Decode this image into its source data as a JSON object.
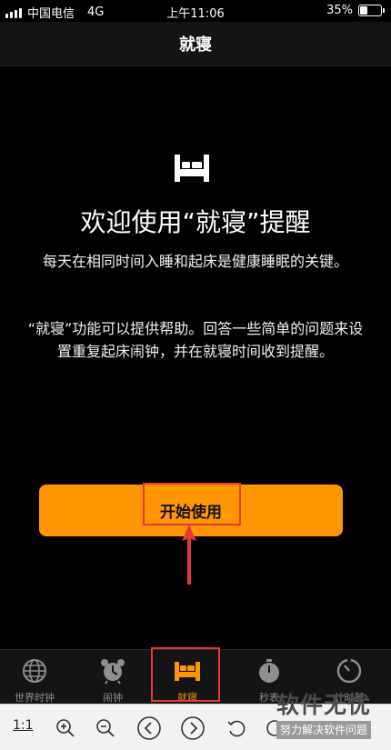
{
  "status_bar": {
    "carrier": "中国电信",
    "network": "4G",
    "time": "上午11:06",
    "battery": "35%",
    "battery_level": 0.35
  },
  "nav": {
    "title": "就寝"
  },
  "content": {
    "heading": "欢迎使用“就寝”提醒",
    "paragraph1": "每天在相同时间入睡和起床是健康睡眠的关键。",
    "paragraph2": "“就寝”功能可以提供帮助。回答一些简单的问题来设置重复起床闹钟，并在就寝时间收到提醒。",
    "start_button": "开始使用"
  },
  "tabs": [
    {
      "label": "世界时钟",
      "icon": "globe-icon"
    },
    {
      "label": "闹钟",
      "icon": "alarm-clock-icon"
    },
    {
      "label": "就寝",
      "icon": "bed-icon",
      "active": true
    },
    {
      "label": "秒表",
      "icon": "stopwatch-icon"
    },
    {
      "label": "计时器",
      "icon": "timer-icon"
    }
  ],
  "toolbar": {
    "ratio": "1:1"
  },
  "watermark": {
    "title": "软件无忧",
    "subtitle": "努力解决软件问题"
  },
  "colors": {
    "accent": "#ff9500",
    "annotation": "#e53935"
  }
}
